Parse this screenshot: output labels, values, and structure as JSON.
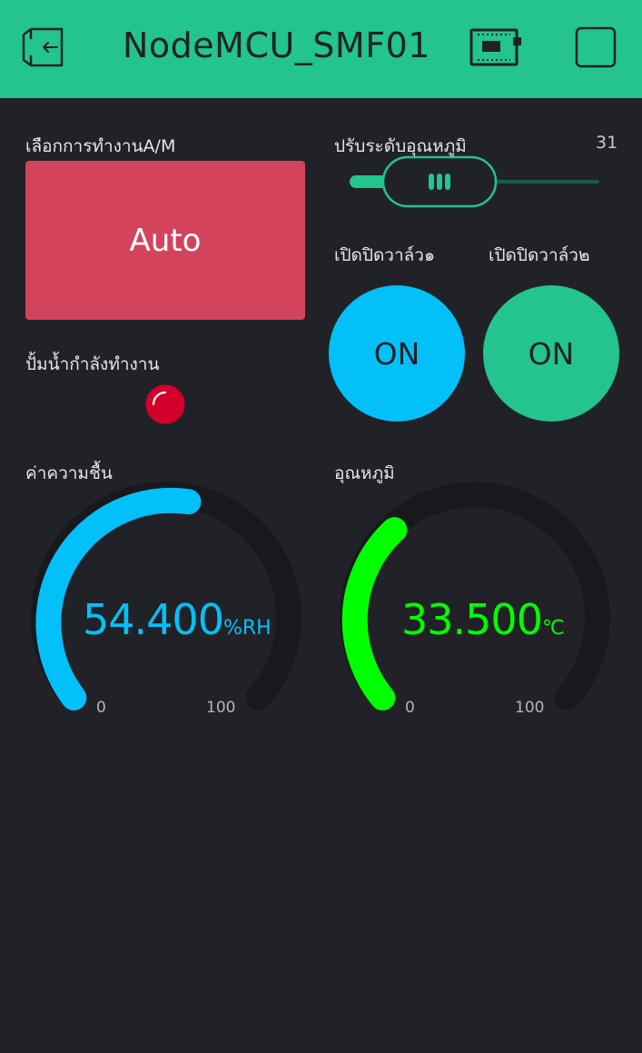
{
  "header": {
    "title": "NodeMCU_SMF01",
    "exit_icon": "exit-icon",
    "device_icon": "device-board-icon",
    "stop_icon": "stop-square-icon",
    "background_color": "#23c48e"
  },
  "mode": {
    "label": "เลือกการทำงานA/M",
    "button_text": "Auto",
    "color": "#d3435c"
  },
  "temp_slider": {
    "label": "ปรับระดับอุณหภูมิ",
    "value": "31",
    "color": "#23c48e"
  },
  "valve1": {
    "label": "เปิดปิดวาล์ว๑",
    "button_text": "ON",
    "color": "#04c0f8"
  },
  "valve2": {
    "label": "เปิดปิดวาล์ว๒",
    "button_text": "ON",
    "color": "#23c48e"
  },
  "pump": {
    "label": "ปั้มน้ำกำลังทำงาน",
    "led_color": "#d3002c"
  },
  "humidity_gauge": {
    "label": "ค่าความชื้น",
    "value": "54.400",
    "unit": "%RH",
    "min": "0",
    "max": "100",
    "color": "#04c0f8"
  },
  "temperature_gauge": {
    "label": "อุณหภูมิ",
    "value": "33.500",
    "unit": "℃",
    "min": "0",
    "max": "100",
    "color": "#00ff00"
  }
}
